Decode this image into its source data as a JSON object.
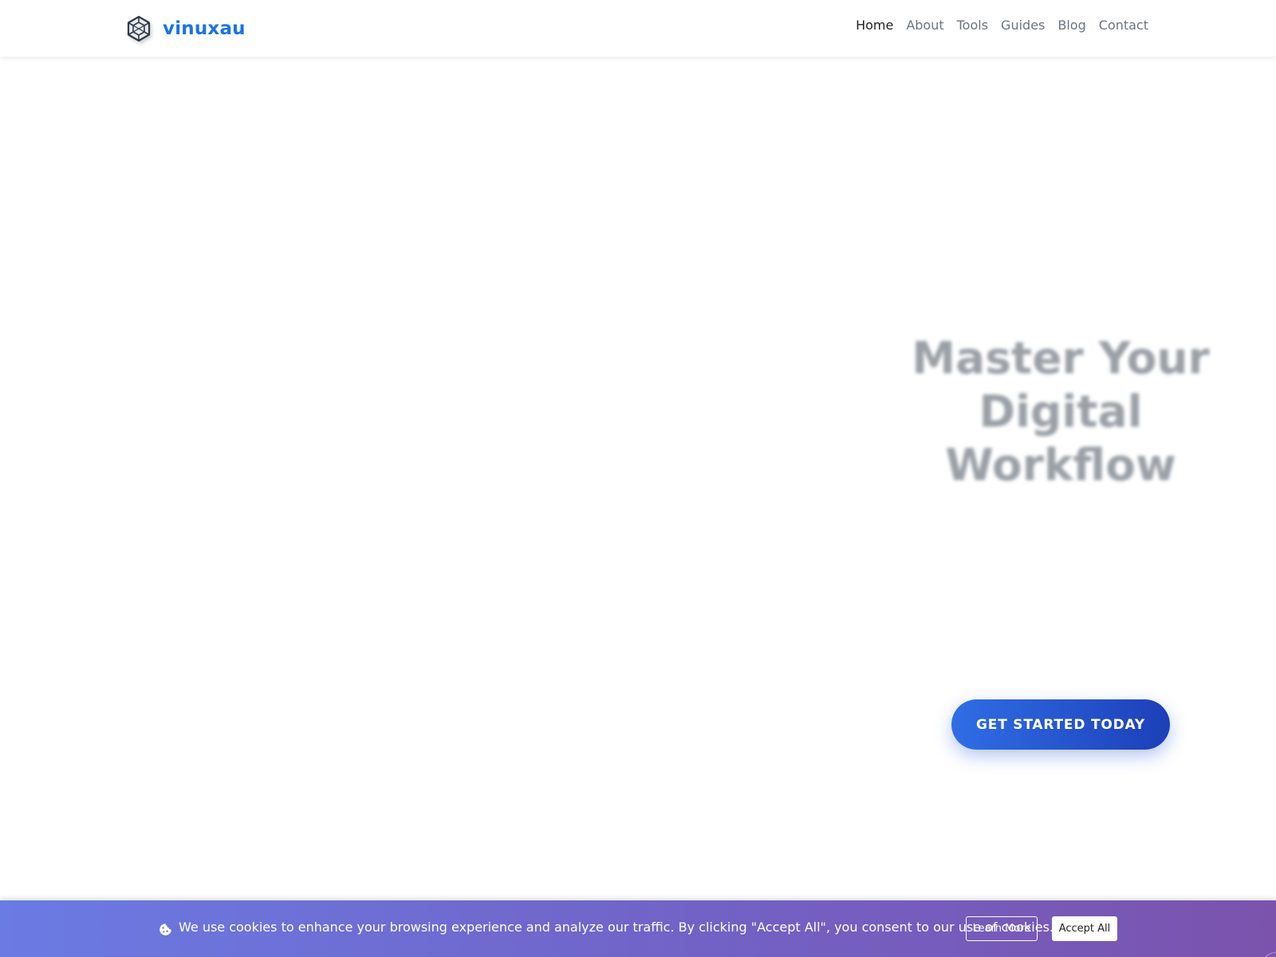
{
  "colors": {
    "brand": "#1a73e8",
    "cta_start": "#2f6ee6",
    "cta_end": "#1d3fb8",
    "banner_start": "#6a7be3",
    "banner_end": "#7b53ad"
  },
  "header": {
    "logo_icon": "cube-wireframe-icon",
    "brand": "vinuxau",
    "nav": [
      {
        "label": "Home",
        "active": true
      },
      {
        "label": "About",
        "active": false
      },
      {
        "label": "Tools",
        "active": false
      },
      {
        "label": "Guides",
        "active": false
      },
      {
        "label": "Blog",
        "active": false
      },
      {
        "label": "Contact",
        "active": false
      }
    ]
  },
  "hero": {
    "title_line1": "Master Your",
    "title_line2": "Digital",
    "title_line3": "Workflow",
    "cta_label": "GET STARTED TODAY"
  },
  "cookie_banner": {
    "icon": "cookie-icon",
    "message": "We use cookies to enhance your browsing experience and analyze our traffic. By clicking \"Accept All\", you consent to our use of cookies.",
    "learn_more_label": "Learn More",
    "accept_label": "Accept All"
  }
}
